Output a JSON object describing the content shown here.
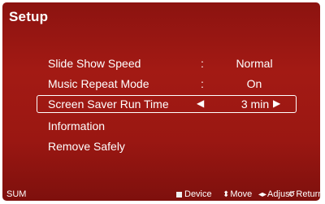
{
  "title": "Setup",
  "menu": [
    {
      "label": "Slide Show Speed",
      "sep": ":",
      "value": "Normal"
    },
    {
      "label": "Music Repeat Mode",
      "sep": ":",
      "value": "On"
    },
    {
      "label": "Screen Saver Run Time",
      "value": "3 min",
      "arrow_left": "◀",
      "arrow_right": "▶"
    },
    {
      "label": "Information"
    },
    {
      "label": "Remove Safely"
    }
  ],
  "footer": {
    "source": "SUM",
    "device": "Device",
    "move_icon": "updown-arrow-icon",
    "move": "Move",
    "adjust_icon": "leftright-arrow-icon",
    "adjust": "Adjust",
    "return_icon": "return-icon",
    "return": "Return"
  }
}
